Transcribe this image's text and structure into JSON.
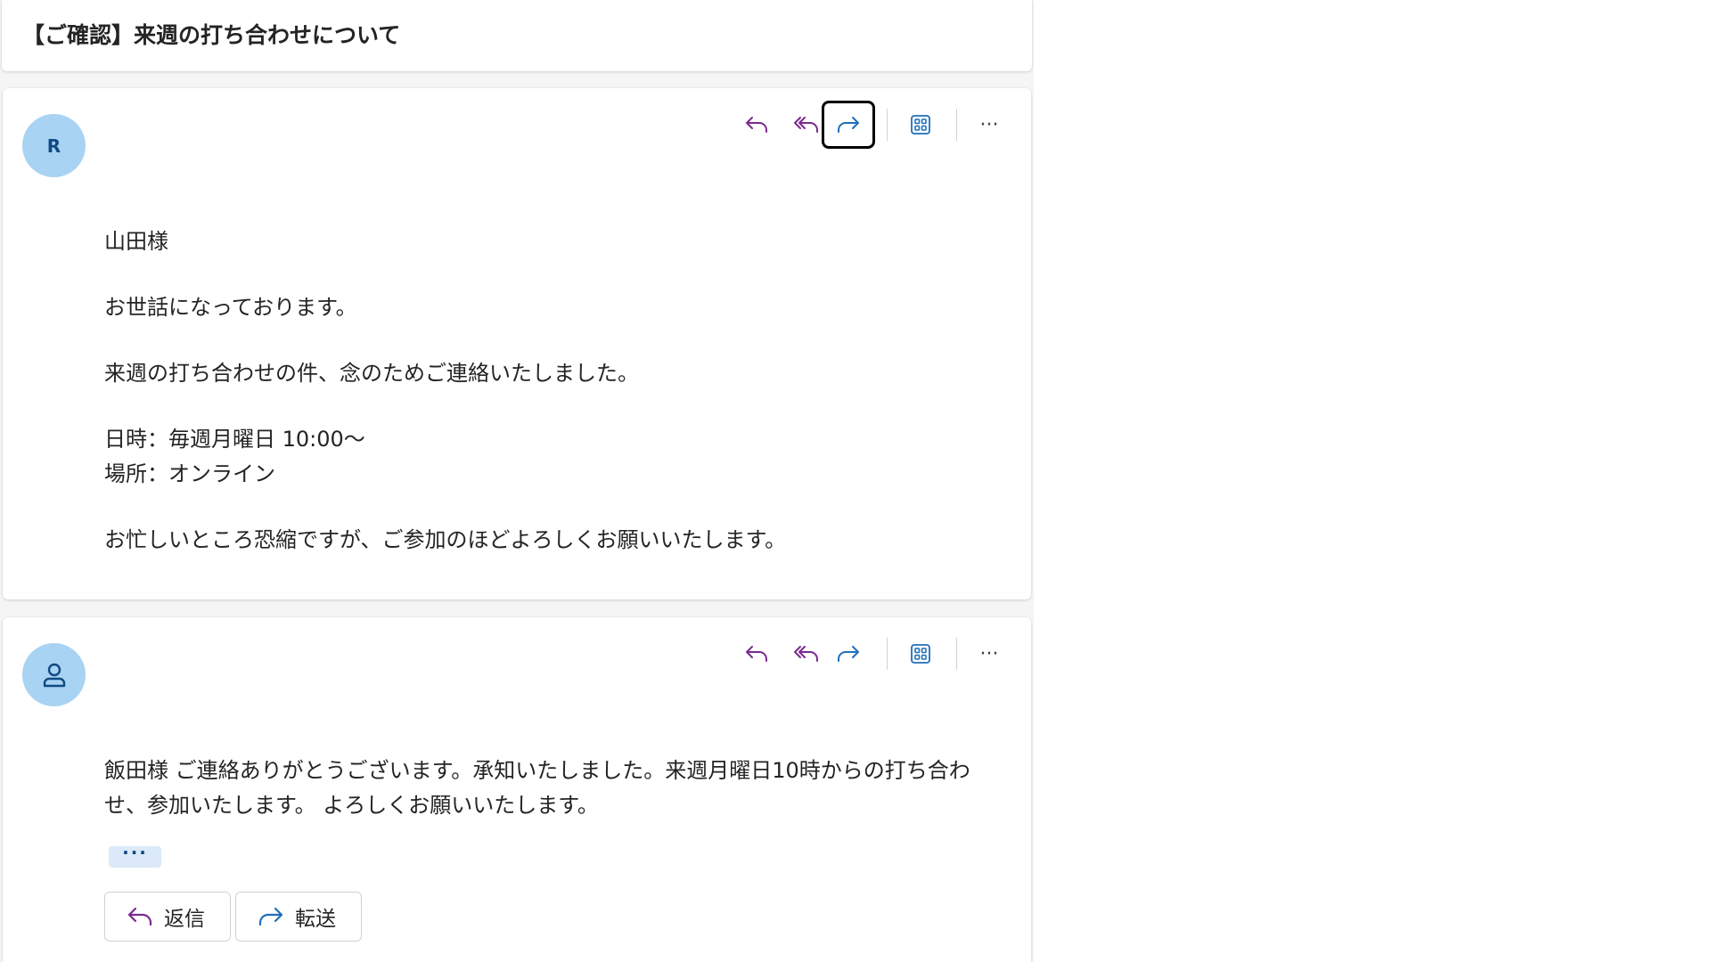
{
  "subject": "【ご確認】来週の打ち合わせについて",
  "colors": {
    "reply_icon": "#7a2a8f",
    "forward_icon": "#1f6fba",
    "apps_icon": "#1f6fba",
    "avatar_bg": "#a9d3f2",
    "avatar_fg": "#0f4a85"
  },
  "messages": [
    {
      "avatar_initial": "R",
      "toolbar": {
        "reply_icon": "reply-icon",
        "reply_all_icon": "reply-all-icon",
        "forward_icon": "forward-icon",
        "apps_icon": "apps-icon",
        "more_label": "···"
      },
      "body": {
        "greeting": "山田様",
        "line1": "お世話になっております。",
        "line2": "来週の打ち合わせの件、念のためご連絡いたしました。",
        "datetime": "日時：毎週月曜日 10:00〜",
        "place": "場所：オンライン",
        "closing": "お忙しいところ恐縮ですが、ご参加のほどよろしくお願いいたします。"
      }
    },
    {
      "avatar_icon": "person-icon",
      "toolbar": {
        "more_label": "···"
      },
      "body": {
        "text": "飯田様 ご連絡ありがとうございます。承知いたしました。来週月曜日10時からの打ち合わせ、参加いたします。 よろしくお願いいたします。"
      },
      "expand_label": "···",
      "reply_label": "返信",
      "forward_label": "転送"
    }
  ]
}
